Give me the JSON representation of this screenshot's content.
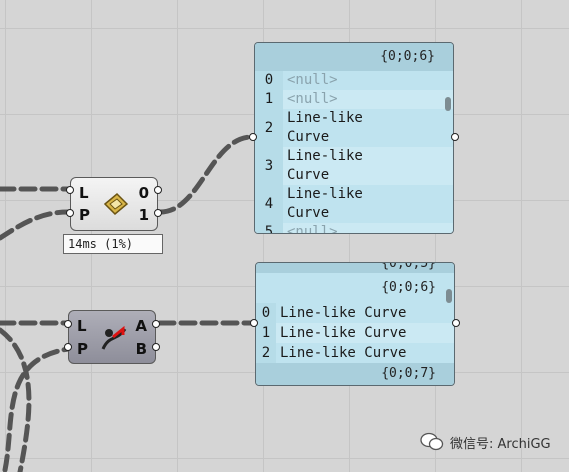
{
  "components": {
    "top": {
      "inputs": [
        "L",
        "P"
      ],
      "outputs": [
        "0",
        "1"
      ],
      "icon": "evaluate-length-icon",
      "profiler": "14ms (1%)"
    },
    "bottom": {
      "inputs": [
        "L",
        "P"
      ],
      "outputs": [
        "A",
        "B"
      ],
      "icon": "curve-closest-point-icon"
    }
  },
  "panel1": {
    "path": "{0;0;6}",
    "rows": [
      {
        "index": "0",
        "lines": [
          "<null>"
        ]
      },
      {
        "index": "1",
        "lines": [
          "<null>"
        ]
      },
      {
        "index": "2",
        "lines": [
          "Line-like",
          "Curve"
        ]
      },
      {
        "index": "3",
        "lines": [
          "Line-like",
          "Curve"
        ]
      },
      {
        "index": "4",
        "lines": [
          "Line-like",
          "Curve"
        ]
      },
      {
        "index": "5",
        "lines": [
          "<null>"
        ]
      }
    ]
  },
  "panel2": {
    "path_top_partial": "{0;0;5}",
    "path": "{0;0;6}",
    "rows": [
      {
        "index": "0",
        "value": "Line-like Curve"
      },
      {
        "index": "1",
        "value": "Line-like Curve"
      },
      {
        "index": "2",
        "value": "Line-like Curve"
      }
    ],
    "path_bottom": "{0;0;7}"
  },
  "watermark": {
    "text": "微信号: ArchiGG",
    "icon": "wechat-icon"
  },
  "colors": {
    "panel_bg": "#bfe3ef",
    "panel_header": "#a9cfdc",
    "wire": "#555555",
    "canvas": "#d5d5d5"
  }
}
